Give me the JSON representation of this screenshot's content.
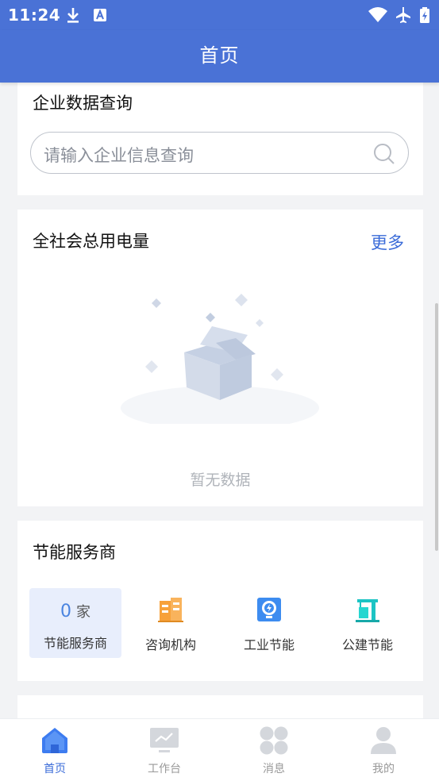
{
  "status_bar": {
    "time": "11:24",
    "icons": [
      "download-icon",
      "a-badge-icon",
      "wifi-icon",
      "airplane-icon",
      "battery-charging-icon"
    ]
  },
  "header": {
    "title": "首页"
  },
  "company_search": {
    "title": "企业数据查询",
    "placeholder": "请输入企业信息查询",
    "icon": "search-icon"
  },
  "electricity": {
    "title": "全社会总用电量",
    "more_label": "更多",
    "empty_text": "暂无数据"
  },
  "providers": {
    "title": "节能服务商",
    "count": "0",
    "count_unit": "家",
    "count_label": "节能服务商",
    "items": [
      {
        "label": "咨询机构",
        "icon": "building-icon",
        "color": "#f7a13a"
      },
      {
        "label": "工业节能",
        "icon": "lightbulb-icon",
        "color": "#3d8cf0"
      },
      {
        "label": "公建节能",
        "icon": "crane-icon",
        "color": "#1cc4c4"
      }
    ]
  },
  "tabbar": {
    "items": [
      {
        "label": "首页",
        "icon": "home-icon",
        "active": true
      },
      {
        "label": "工作台",
        "icon": "monitor-icon",
        "active": false
      },
      {
        "label": "消息",
        "icon": "grid-icon",
        "active": false
      },
      {
        "label": "我的",
        "icon": "user-icon",
        "active": false
      }
    ]
  },
  "colors": {
    "primary": "#4a72d6",
    "accent_blue": "#3a6bd8",
    "background": "#f2f3f5"
  }
}
